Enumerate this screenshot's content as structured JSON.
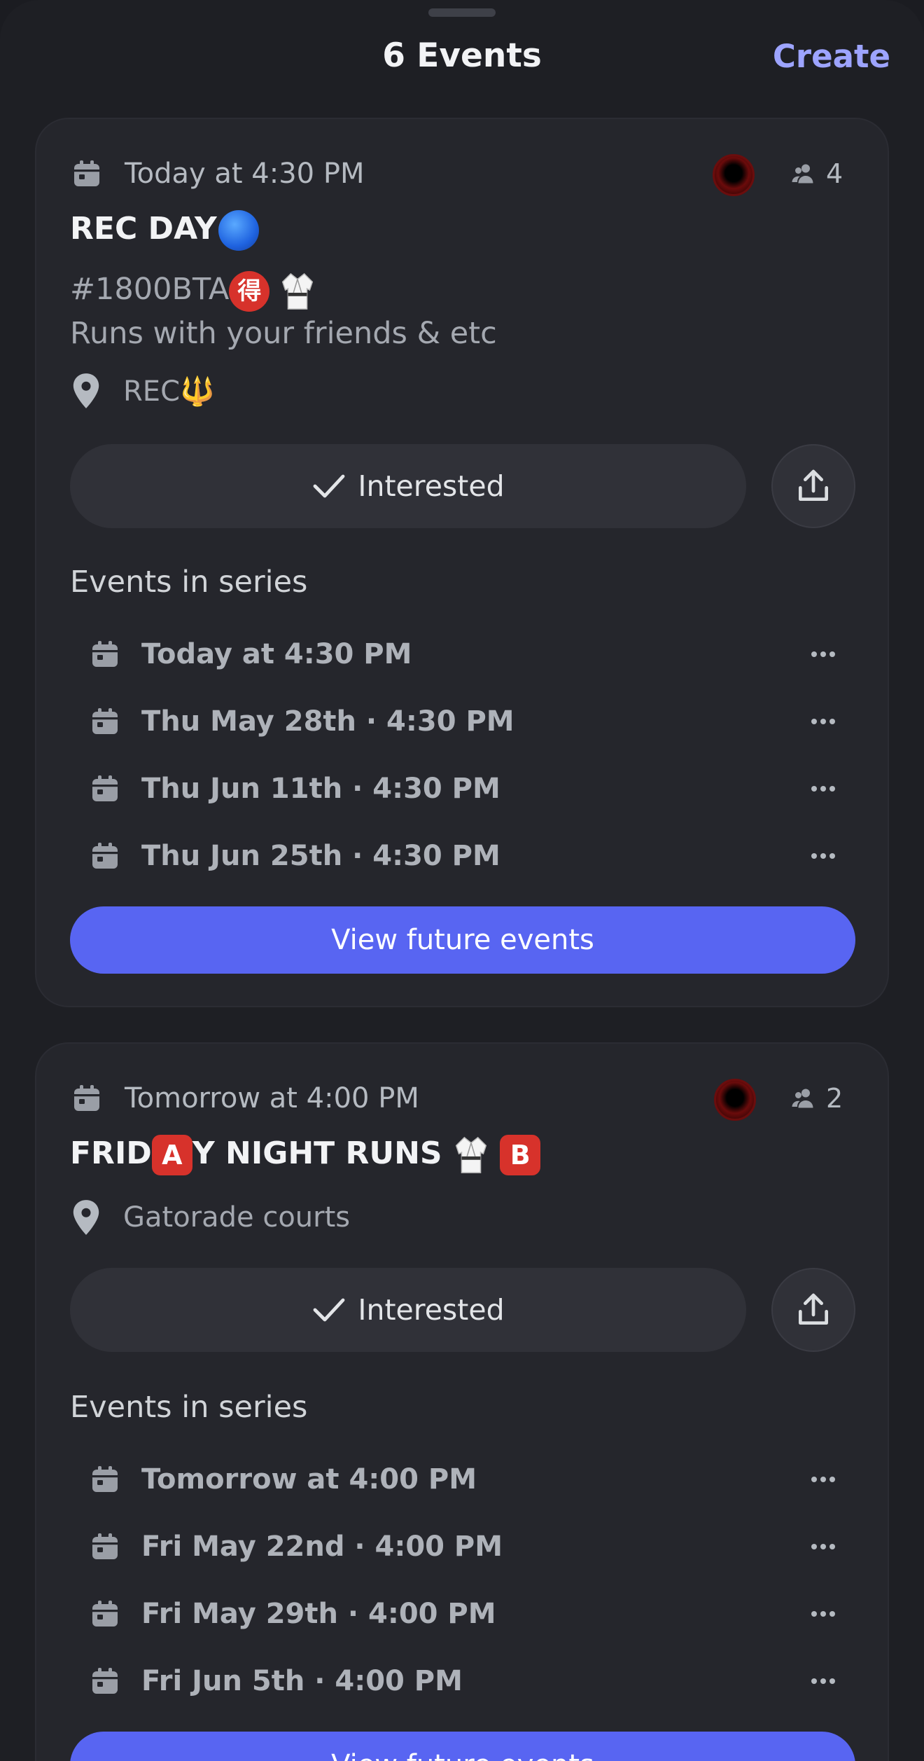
{
  "header": {
    "title": "6 Events",
    "create_label": "Create"
  },
  "events": [
    {
      "date": "Today at 4:30 PM",
      "interested_count": "4",
      "title": "REC DAY",
      "description_line1": "#1800BTA",
      "description_line1_emoji_badge": "得",
      "description_line2": "Runs with your friends & etc",
      "location": "REC",
      "location_emoji": "🔱",
      "interested_label": "Interested",
      "series_heading": "Events in series",
      "series": [
        "Today at 4:30 PM",
        "Thu May 28th · 4:30 PM",
        "Thu Jun 11th · 4:30 PM",
        "Thu Jun 25th · 4:30 PM"
      ],
      "future_label": "View future events"
    },
    {
      "date": "Tomorrow at 4:00 PM",
      "interested_count": "2",
      "title_part1": "FRID",
      "title_badge1": "A",
      "title_part2": "Y NIGHT RUNS",
      "title_badge2": "B",
      "location": "Gatorade courts",
      "interested_label": "Interested",
      "series_heading": "Events in series",
      "series": [
        "Tomorrow at 4:00 PM",
        "Fri May 22nd · 4:00 PM",
        "Fri May 29th · 4:00 PM",
        "Fri Jun 5th · 4:00 PM"
      ],
      "future_label": "View future events"
    }
  ],
  "colors": {
    "accent": "#5865f2",
    "create": "#9da4ff",
    "card": "#25262c"
  }
}
